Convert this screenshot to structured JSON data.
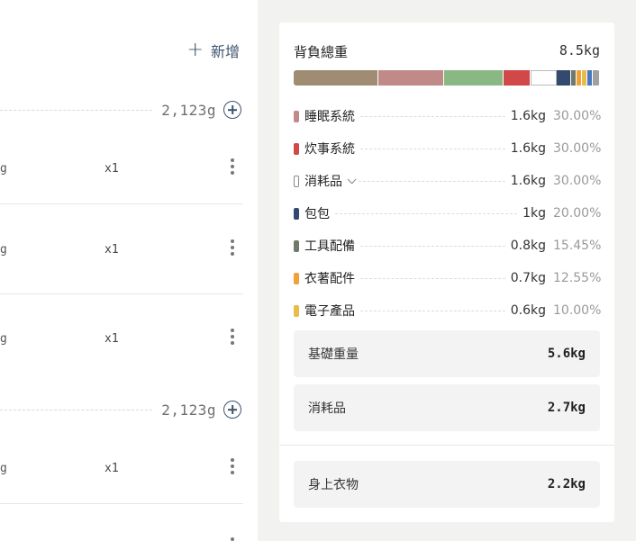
{
  "left": {
    "add_label": "新增",
    "categories": [
      {
        "weight": "2,123g"
      },
      {
        "weight": "2,123g"
      }
    ],
    "items": [
      {
        "unit": "g",
        "qty": "x1"
      },
      {
        "unit": "g",
        "qty": "x1"
      },
      {
        "unit": "g",
        "qty": "x1"
      },
      {
        "unit": "g",
        "qty": "x1"
      }
    ]
  },
  "summary": {
    "title": "背負總重",
    "total": "8.5kg",
    "categories": [
      {
        "name": "睡眠系統",
        "kg": "1.6kg",
        "pct": "30.00%",
        "color": "#c08a88"
      },
      {
        "name": "炊事系統",
        "kg": "1.6kg",
        "pct": "30.00%",
        "color": "#d04848"
      },
      {
        "name": "消耗品",
        "kg": "1.6kg",
        "pct": "30.00%",
        "color": "#ffffff"
      },
      {
        "name": "包包",
        "kg": "1kg",
        "pct": "20.00%",
        "color": "#334a6e"
      },
      {
        "name": "工具配備",
        "kg": "0.8kg",
        "pct": "15.45%",
        "color": "#6f7a6a"
      },
      {
        "name": "衣著配件",
        "kg": "0.7kg",
        "pct": "12.55%",
        "color": "#f0a23a"
      },
      {
        "name": "電子產品",
        "kg": "0.6kg",
        "pct": "10.00%",
        "color": "#e8bc4a"
      }
    ],
    "stack": [
      {
        "color": "#a08c72",
        "share": 0.275
      },
      {
        "color": "#c08a88",
        "share": 0.215
      },
      {
        "color": "#8ab884",
        "share": 0.195
      },
      {
        "color": "#d04848",
        "share": 0.088
      },
      {
        "color": "#ffffff",
        "share": 0.085,
        "empty": true
      },
      {
        "color": "#334a6e",
        "share": 0.047
      },
      {
        "color": "#6f7a6a",
        "share": 0.018
      },
      {
        "color": "#f0a23a",
        "share": 0.018
      },
      {
        "color": "#e8bc4a",
        "share": 0.018
      },
      {
        "color": "#4a78c0",
        "share": 0.018
      },
      {
        "color": "#a0a0a0",
        "share": 0.023
      }
    ],
    "cards": [
      {
        "label": "基礎重量",
        "value": "5.6kg"
      },
      {
        "label": "消耗品",
        "value": "2.7kg"
      },
      {
        "label": "身上衣物",
        "value": "2.2kg"
      }
    ]
  }
}
